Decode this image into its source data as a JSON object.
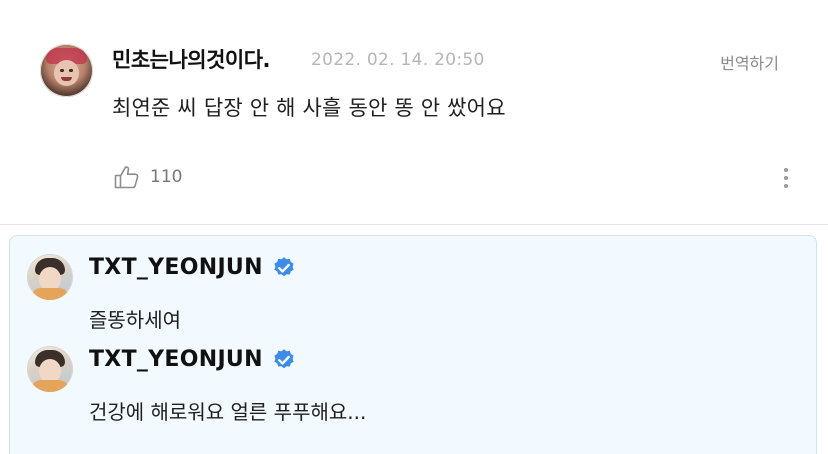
{
  "comment": {
    "username": "민초는나의것이다.",
    "timestamp": "2022. 02. 14. 20:50",
    "translate_label": "번역하기",
    "text": "최연준 씨 답장 안 해 사흘 동안 똥 안 쌌어요",
    "like_count": "110",
    "icons": {
      "like": "thumbs-up-icon",
      "more": "more-vertical-icon",
      "avatar": "user-avatar"
    }
  },
  "replies": [
    {
      "name": "TXT_YEONJUN",
      "verified": true,
      "text": "즐똥하세여"
    },
    {
      "name": "TXT_YEONJUN",
      "verified": true,
      "text": "건강에 해로워요 얼른 푸푸해요..."
    }
  ],
  "colors": {
    "reply_background": "#f2f9ff",
    "reply_border": "#cfe2f4",
    "verified_badge": "#3d8ce8",
    "timestamp": "#b6b6b6"
  }
}
